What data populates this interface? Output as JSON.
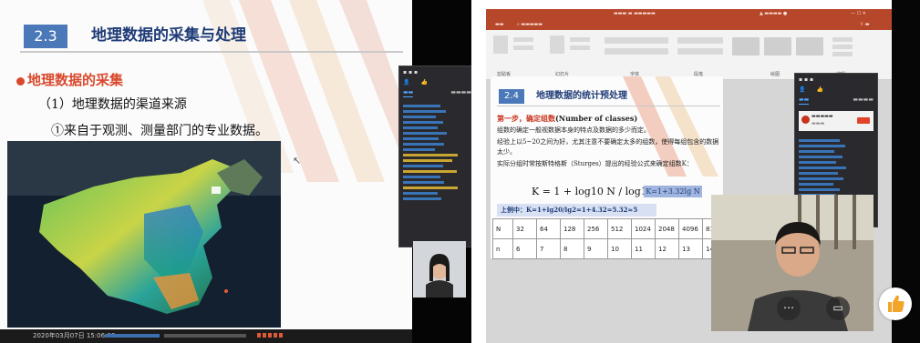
{
  "left": {
    "section_number": "2.3",
    "slide_title": "地理数据的采集与处理",
    "heading": "地理数据的采集",
    "subheading": "（1）地理数据的渠道来源",
    "item": "①来自于观测、测量部门的专业数据。",
    "status_time": "2020年03月07日 15:06:08"
  },
  "right": {
    "ribbon_labels": [
      "剪贴板",
      "幻灯片",
      "字体",
      "段落",
      "绘图",
      "编辑"
    ],
    "section_number": "2.4",
    "slide_title": "地理数据的统计预处理",
    "step_label": "第一步，确定组数",
    "step_english": "(Number of classes)",
    "para1": "组数的确定一般视数据本身的特点及数据的多少而定。",
    "para2": "经验上以5~20之间为好，尤其注意不要确定太多的组数，使得每组包含的数据太少。",
    "para3": "实际分组时常按斯特格斯（Sturges）提出的经验公式来确定组数K：",
    "formula": "K = 1 + log10 N / log10 2",
    "formula_box": "K=1+3.32lg N",
    "example": "上例中：K=1+lg20/lg2=1+4.32=5.32≈5",
    "table": {
      "row_n": [
        "N",
        "32",
        "64",
        "128",
        "256",
        "512",
        "1024",
        "2048",
        "4096",
        "81"
      ],
      "row_k": [
        "n",
        "6",
        "7",
        "8",
        "9",
        "10",
        "11",
        "12",
        "13",
        "14"
      ]
    }
  },
  "colors": {
    "accent_blue": "#4a78b8",
    "title_navy": "#1f3c77",
    "heading_red": "#d9482b",
    "ppt_red": "#b7472a"
  }
}
